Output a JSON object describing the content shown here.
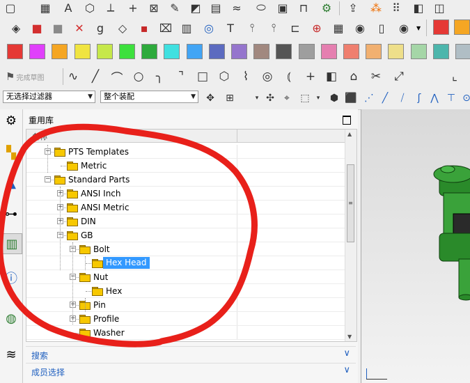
{
  "colors": {
    "accent": "#1f5fbf",
    "selection": "#3399ff",
    "annotation": "#e8201a",
    "part_green": "#3aa23a"
  },
  "toolbar_row1": {
    "icons": [
      "document-icon",
      "grid-icon",
      "text-A-icon",
      "cube-axes-icon",
      "axes-icon",
      "plus-icon",
      "cross-box-icon",
      "sketch-icon",
      "surface-icon",
      "mesh-icon",
      "wave-icon",
      "cylinder-icon",
      "block-icon",
      "holder-icon",
      "gear-icon",
      "arrow-box-icon",
      "blocks-icon",
      "dots-icon",
      "shape-icon",
      "swatch-icon"
    ]
  },
  "toolbar_row2": {
    "icons": [
      "solid-icon",
      "red-solid-icon",
      "gray-solid-icon",
      "x-solid-icon",
      "g-letter-icon",
      "wire-icon",
      "red-cube-icon",
      "frame-icon",
      "text-grid-icon",
      "target-icon",
      "tee-icon",
      "screw-icon",
      "screw2-icon",
      "bracket-icon",
      "crosshair-icon",
      "table-icon",
      "dial-icon",
      "panel-icon",
      "eye-icon"
    ],
    "swatches": [
      "#e53935",
      "#f5a623"
    ]
  },
  "palette": [
    "#e53935",
    "#e040fb",
    "#f5a623",
    "#f0e440",
    "#c6e84a",
    "#3de03d",
    "#2eaa3c",
    "#40e0e0",
    "#42a5f5",
    "#5c6bc0",
    "#9575cd",
    "#a1887f",
    "#555555",
    "#9e9e9e",
    "#e57fb0",
    "#ef7f6f",
    "#f1b070",
    "#eedf8a",
    "#a5d6a7",
    "#4db6ac",
    "#b0bec5"
  ],
  "sketch_toolbar": {
    "label": "完成草图",
    "tools": [
      "curve-icon",
      "line-icon",
      "arc-icon",
      "circle-icon",
      "fillet-icon",
      "chamfer-icon",
      "rect-icon",
      "polygon-icon",
      "spline-icon",
      "ellipse-icon",
      "conic-icon",
      "point-icon",
      "shape-icon",
      "offset-icon",
      "trim-icon",
      "extend-icon",
      "corner-icon"
    ]
  },
  "filter_bar": {
    "filter_value": "无选择过滤器",
    "assembly_value": "整个装配"
  },
  "side_rail": {
    "icons": [
      "settings-icon",
      "assembly-navigator-icon",
      "constraint-navigator-icon",
      "part-navigator-icon",
      "reuse-library-icon",
      "info-icon",
      "web-browser-icon",
      "history-icon"
    ]
  },
  "panel": {
    "title": "重用库",
    "column_header": "名称",
    "tree": [
      {
        "label": "PTS Templates",
        "level": 1,
        "expander": "−"
      },
      {
        "label": "Metric",
        "level": 2,
        "expander": ""
      },
      {
        "label": "Standard Parts",
        "level": 1,
        "expander": "−"
      },
      {
        "label": "ANSI Inch",
        "level": 2,
        "expander": "+"
      },
      {
        "label": "ANSI Metric",
        "level": 2,
        "expander": "+"
      },
      {
        "label": "DIN",
        "level": 2,
        "expander": "+"
      },
      {
        "label": "GB",
        "level": 2,
        "expander": "−"
      },
      {
        "label": "Bolt",
        "level": 3,
        "expander": "−"
      },
      {
        "label": "Hex Head",
        "level": 4,
        "expander": "",
        "selected": true
      },
      {
        "label": "Nut",
        "level": 3,
        "expander": "−"
      },
      {
        "label": "Hex",
        "level": 4,
        "expander": ""
      },
      {
        "label": "Pin",
        "level": 3,
        "expander": "+"
      },
      {
        "label": "Profile",
        "level": 3,
        "expander": "+"
      },
      {
        "label": "Washer",
        "level": 3,
        "expander": ""
      }
    ],
    "search_label": "搜索",
    "member_select_label": "成员选择"
  }
}
